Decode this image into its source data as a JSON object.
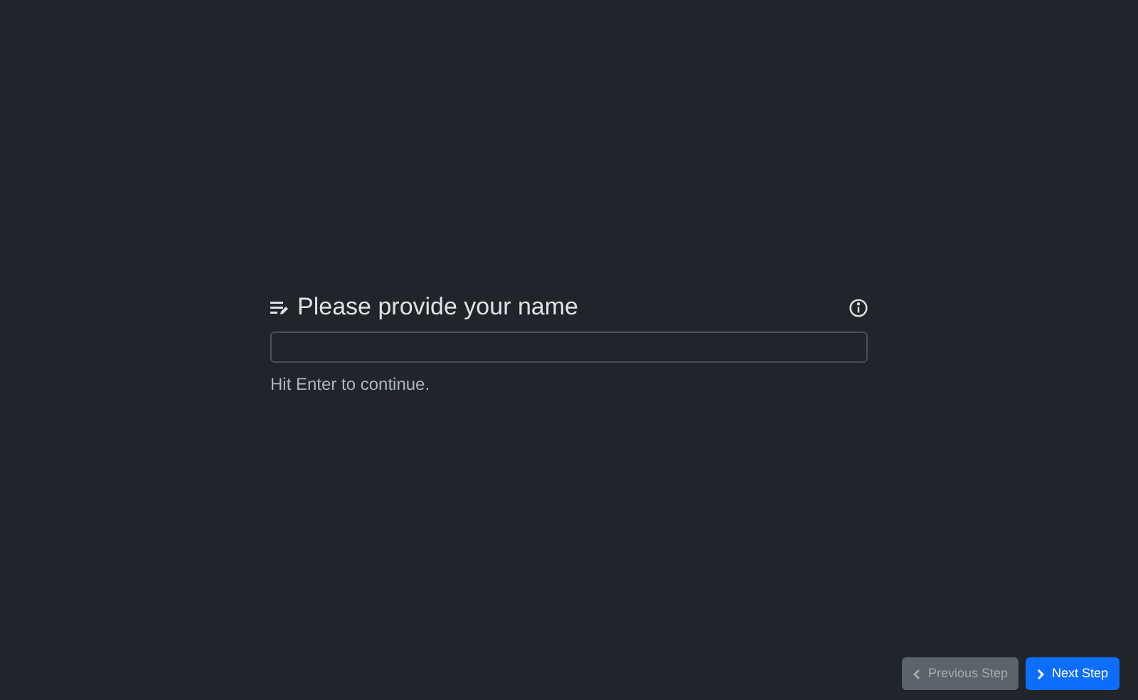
{
  "question": {
    "title": "Please provide your name",
    "hint": "Hit Enter to continue."
  },
  "buttons": [
    {
      "label": "Previous Step",
      "kind": "previous",
      "disabled": true
    },
    {
      "label": "Next Step",
      "kind": "next",
      "disabled": false
    }
  ]
}
